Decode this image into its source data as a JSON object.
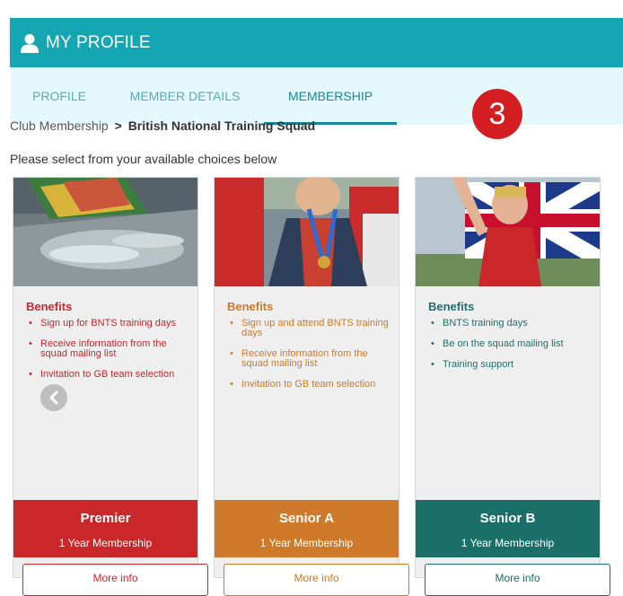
{
  "header": {
    "title": "MY PROFILE",
    "icon": "user-icon",
    "color": "#15a6b4"
  },
  "tabs": [
    {
      "label": "PROFILE",
      "active": false
    },
    {
      "label": "MEMBER DETAILS",
      "active": false
    },
    {
      "label": "MEMBERSHIP",
      "active": true
    }
  ],
  "step_badge": "3",
  "breadcrumb": {
    "parent": "Club Membership",
    "separator": ">",
    "current": "British National Training Squad"
  },
  "instruction": "Please select from your available choices below",
  "cards": [
    {
      "benefits_heading": "Benefits",
      "benefits": [
        "Sign up for BNTS training days",
        "Receive information from the squad mailing list",
        "Invitation to GB team selection"
      ],
      "name": "Premier",
      "term": "1 Year Membership",
      "more": "More info",
      "color": "#c9272a"
    },
    {
      "benefits_heading": "Benefits",
      "benefits": [
        "Sign up and attend BNTS training days",
        "Receive information from the squad mailing list",
        "Invitation to GB team selection"
      ],
      "name": "Senior A",
      "term": "1 Year Membership",
      "more": "More info",
      "color": "#cf7a2a"
    },
    {
      "benefits_heading": "Benefits",
      "benefits": [
        "BNTS training days",
        "Be on the squad mailing list",
        "Training support"
      ],
      "name": "Senior B",
      "term": "1 Year Membership",
      "more": "More info",
      "color": "#1a6f69"
    }
  ]
}
